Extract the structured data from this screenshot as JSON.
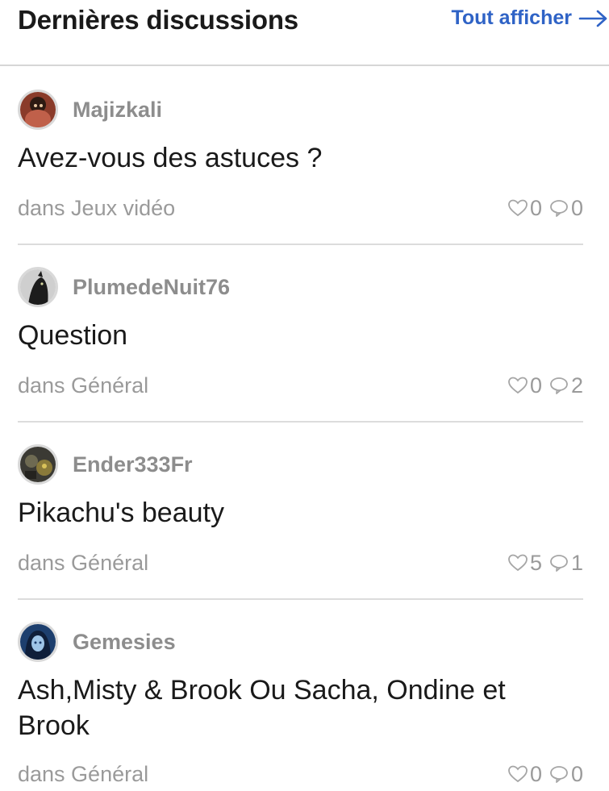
{
  "header": {
    "title": "Dernières discussions",
    "view_all_label": "Tout afficher"
  },
  "discussions": [
    {
      "author": "Majizkali",
      "title": "Avez-vous des astuces ?",
      "category": "dans Jeux vidéo",
      "likes": "0",
      "replies": "0"
    },
    {
      "author": "PlumedeNuit76",
      "title": "Question",
      "category": "dans Général",
      "likes": "0",
      "replies": "2"
    },
    {
      "author": "Ender333Fr",
      "title": "Pikachu's beauty",
      "category": "dans Général",
      "likes": "5",
      "replies": "1"
    },
    {
      "author": "Gemesies",
      "title": "Ash,Misty & Brook Ou Sacha, Ondine et Brook",
      "category": "dans Général",
      "likes": "0",
      "replies": "0"
    }
  ],
  "colors": {
    "link": "#2f63c6",
    "muted": "#9a9a9a",
    "divider": "#dcdcdc"
  },
  "icons": [
    "arrow-right-icon",
    "heart-icon",
    "speech-bubble-icon"
  ]
}
